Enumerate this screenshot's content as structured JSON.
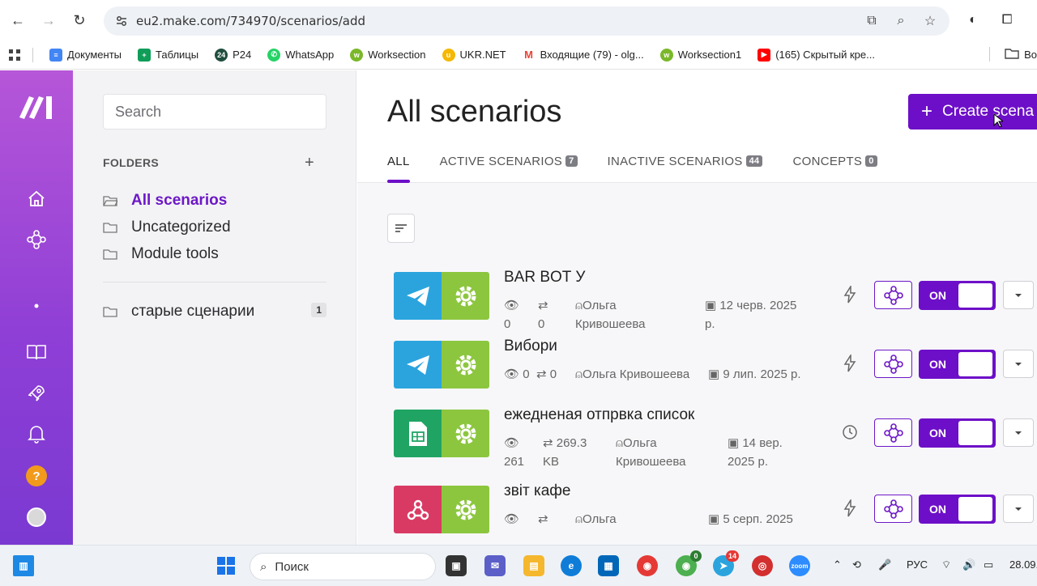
{
  "browser": {
    "url": "eu2.make.com/734970/scenarios/add"
  },
  "bookmarks": [
    {
      "label": "Документы",
      "color": "#4285f4",
      "icon": "docs-icon"
    },
    {
      "label": "Таблицы",
      "color": "#0f9d58",
      "icon": "sheets-icon"
    },
    {
      "label": "P24",
      "color": "#1f4e3d",
      "icon": "p24-icon"
    },
    {
      "label": "WhatsApp",
      "color": "#25d366",
      "icon": "whatsapp-icon"
    },
    {
      "label": "Worksection",
      "color": "#7ab829",
      "icon": "worksection-icon"
    },
    {
      "label": "UKR.NET",
      "color": "#f5b700",
      "icon": "ukrnet-icon"
    },
    {
      "label": "Входящие (79) - olg...",
      "color": "#ea4335",
      "icon": "gmail-icon"
    },
    {
      "label": "Worksection1",
      "color": "#7ab829",
      "icon": "worksection-icon"
    },
    {
      "label": "(165) Скрытый кре...",
      "color": "#ff0000",
      "icon": "youtube-icon"
    }
  ],
  "bookmarks_right": "Во",
  "sidebar": {
    "search_placeholder": "Search",
    "folders_title": "FOLDERS",
    "add_label": "+",
    "items": [
      {
        "label": "All scenarios"
      },
      {
        "label": "Uncategorized"
      },
      {
        "label": "Module tools"
      }
    ],
    "extra_folder": {
      "label": "старые сценарии",
      "count": "1"
    }
  },
  "main": {
    "title": "All scenarios",
    "create_label": "Create scena",
    "tabs": [
      {
        "label": "ALL",
        "badge": ""
      },
      {
        "label": "ACTIVE SCENARIOS",
        "badge": "7"
      },
      {
        "label": "INACTIVE SCENARIOS",
        "badge": "44"
      },
      {
        "label": "CONCEPTS",
        "badge": "0"
      }
    ]
  },
  "scenarios": [
    {
      "name": "BAR BOT У",
      "apps": [
        "telegram",
        "tools"
      ],
      "ops": "0",
      "transfer": "0",
      "author": "Ольга Кривошеева",
      "date": "12 черв. 2025 р.",
      "trigger": "instant-icon",
      "toggle": "ON"
    },
    {
      "name": "Вибори",
      "apps": [
        "telegram",
        "tools"
      ],
      "ops": "0",
      "transfer": "0",
      "author": "Ольга Кривошеева",
      "date": "9 лип. 2025 р.",
      "trigger": "instant-icon",
      "toggle": "ON"
    },
    {
      "name": "ежедненая отпрвка список",
      "apps": [
        "google-sheets",
        "tools"
      ],
      "ops": "261",
      "transfer": "269.3 KB",
      "author": "Ольга Кривошеева",
      "date": "14 вер. 2025 р.",
      "trigger": "clock-icon",
      "toggle": "ON"
    },
    {
      "name": "звіт кафе",
      "apps": [
        "webhooks",
        "tools"
      ],
      "ops": "",
      "transfer": "",
      "author": "Ольга",
      "date": "5 серп. 2025",
      "trigger": "instant-icon",
      "toggle": "ON"
    }
  ],
  "taskbar": {
    "search_label": "Поиск",
    "lang": "РУС",
    "date": "28.09.",
    "chrome_badge": "0",
    "telegram_badge": "14"
  },
  "colors": {
    "accent": "#6d0fc8",
    "rail_top": "#b656d8",
    "rail_bottom": "#7a39d1"
  }
}
